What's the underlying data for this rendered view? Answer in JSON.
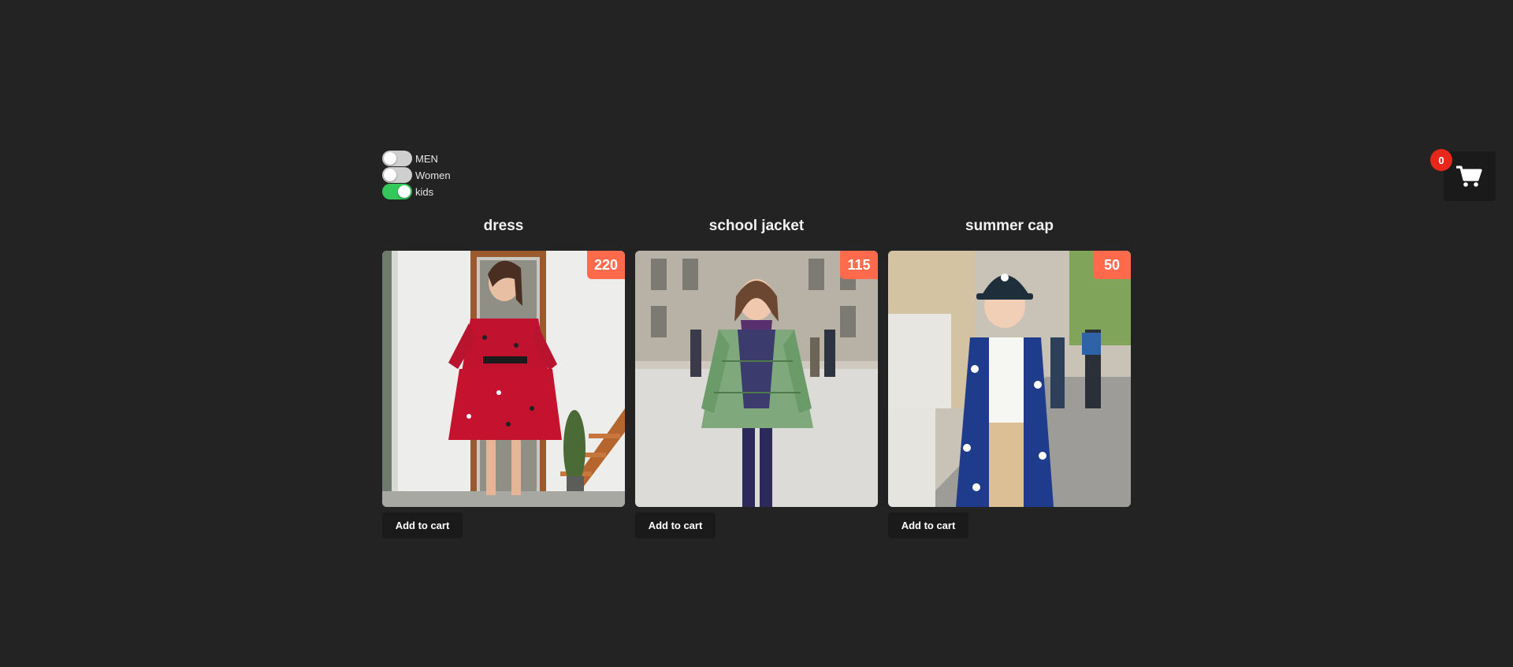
{
  "filters": [
    {
      "label": "MEN",
      "checked": false
    },
    {
      "label": "Women",
      "checked": false
    },
    {
      "label": "kids",
      "checked": true
    }
  ],
  "cart": {
    "count": "0",
    "icon": "shopping-cart-icon"
  },
  "products": [
    {
      "title": "dress",
      "price": "220",
      "button_label": "Add to cart",
      "image": "photo of woman in red floral dress"
    },
    {
      "title": "school jacket",
      "price": "115",
      "button_label": "Add to cart",
      "image": "photo of girl in green plaid jacket"
    },
    {
      "title": "summer cap",
      "price": "50",
      "button_label": "Add to cart",
      "image": "photo of child in navy cap and blue shirt"
    }
  ],
  "colors": {
    "background": "#232323",
    "toggle_on": "#34c759",
    "toggle_off": "#cfcfcf",
    "price_badge": "#ff6a4d",
    "cart_badge": "#e8261a",
    "button": "#1a1a1a"
  }
}
